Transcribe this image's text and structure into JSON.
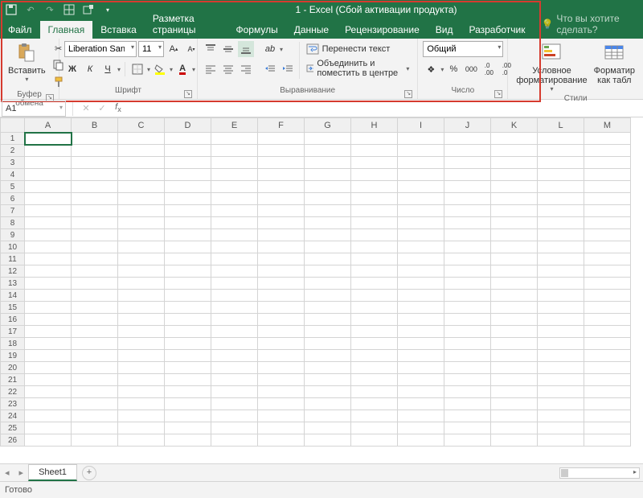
{
  "title": "1 - Excel (Сбой активации продукта)",
  "tabs": {
    "file": "Файл",
    "home": "Главная",
    "insert": "Вставка",
    "layout": "Разметка страницы",
    "formulas": "Формулы",
    "data": "Данные",
    "review": "Рецензирование",
    "view": "Вид",
    "developer": "Разработчик"
  },
  "tell_me": "Что вы хотите сделать?",
  "ribbon": {
    "clipboard": {
      "paste": "Вставить",
      "label": "Буфер обмена"
    },
    "font": {
      "name": "Liberation Sans",
      "size": "11",
      "bold": "Ж",
      "italic": "К",
      "underline": "Ч",
      "label": "Шрифт"
    },
    "alignment": {
      "wrap": "Перенести текст",
      "merge": "Объединить и поместить в центре",
      "label": "Выравнивание"
    },
    "number": {
      "format": "Общий",
      "label": "Число"
    },
    "styles": {
      "cond": "Условное форматирование",
      "table": "Форматир как табл",
      "label": "Стили"
    }
  },
  "name_box": "A1",
  "columns": [
    "A",
    "B",
    "C",
    "D",
    "E",
    "F",
    "G",
    "H",
    "I",
    "J",
    "K",
    "L",
    "M"
  ],
  "rows": [
    "1",
    "2",
    "3",
    "4",
    "5",
    "6",
    "7",
    "8",
    "9",
    "10",
    "11",
    "12",
    "13",
    "14",
    "15",
    "16",
    "17",
    "18",
    "19",
    "20",
    "21",
    "22",
    "23",
    "24",
    "25",
    "26"
  ],
  "sheet_tab": "Sheet1",
  "status": "Готово"
}
